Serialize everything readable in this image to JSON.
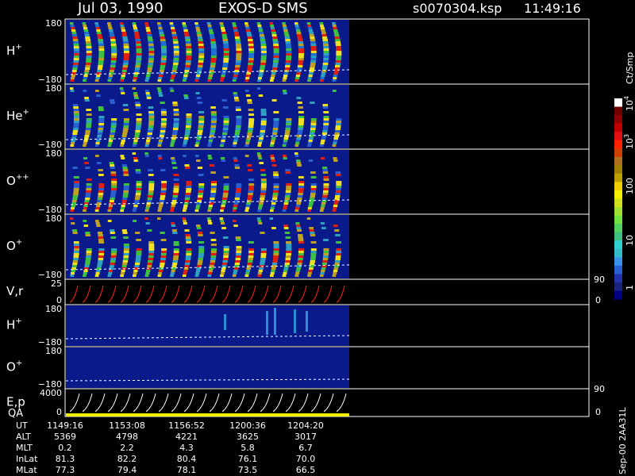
{
  "header": {
    "date": "Jul 03, 1990",
    "instrument": "EXOS-D SMS",
    "file": "s0070304.ksp",
    "time": "11:49:16"
  },
  "colorbar": {
    "unit": "Ct/Smp",
    "ticks": [
      "1",
      "10",
      "100",
      "10",
      "10"
    ],
    "tick_sup": [
      "",
      "",
      "",
      "3",
      "4"
    ],
    "colors": [
      "#000080",
      "#1a237e",
      "#2233aa",
      "#2a5fd0",
      "#3a8fe8",
      "#33bbcc",
      "#30d0d0",
      "#40c080",
      "#50d060",
      "#70e040",
      "#a0e030",
      "#d0e020",
      "#f0f000",
      "#f0d000",
      "#c0a000",
      "#a08000",
      "#b07020",
      "#d04000",
      "#ff2000",
      "#e01010",
      "#c00000",
      "#900000",
      "#700000",
      "#ffffff"
    ]
  },
  "panels": [
    {
      "label": "H",
      "sup": "+",
      "ymax": "180",
      "ymin": "−180",
      "kind": "spectro",
      "palette": [
        "#e02010",
        "#f0e020",
        "#40c040",
        "#2070d0",
        "#30a0c0",
        "#c0a020"
      ]
    },
    {
      "label": "He",
      "sup": "+",
      "ymax": "180",
      "ymin": "−180",
      "kind": "spectro",
      "palette": [
        "#f0e020",
        "#c0a020",
        "#40c040",
        "#2a5fd0",
        "#30a0c0"
      ]
    },
    {
      "label": "O",
      "sup": "++",
      "ymax": "180",
      "ymin": "−180",
      "kind": "spectro",
      "palette": [
        "#e02010",
        "#f0e020",
        "#c0a020",
        "#40c040",
        "#2a5fd0"
      ]
    },
    {
      "label": "O",
      "sup": "+",
      "ymax": "180",
      "ymin": "−180",
      "kind": "spectro",
      "palette": [
        "#c0a020",
        "#e02010",
        "#f0e020",
        "#40c040",
        "#30a0c0"
      ]
    },
    {
      "label": "V,r",
      "sup": "",
      "ymax": "25",
      "ymin": "0",
      "rmax": "90",
      "rmin": "0",
      "kind": "vr"
    },
    {
      "label": "H",
      "sup": "+",
      "ymax": "180",
      "ymin": "−180",
      "kind": "sparse"
    },
    {
      "label": "O",
      "sup": "+",
      "ymax": "180",
      "ymin": "−180",
      "kind": "empty"
    },
    {
      "label": "E,p",
      "label2": "QA",
      "sup": "",
      "ymax": "4000",
      "ymin": "0",
      "rmax": "90",
      "rmin": "0",
      "kind": "ep"
    }
  ],
  "bottom_right_label": "Sep-00 2AA31L",
  "orbit_table": {
    "rows": [
      {
        "name": "UT",
        "values": [
          "1149:16",
          "1153:08",
          "1156:52",
          "1200:36",
          "1204:20"
        ]
      },
      {
        "name": "ALT",
        "values": [
          "5369",
          "4798",
          "4221",
          "3625",
          "3017"
        ]
      },
      {
        "name": "MLT",
        "values": [
          "0.2",
          "2.2",
          "4.3",
          "5.8",
          "6.7"
        ]
      },
      {
        "name": "InLat",
        "values": [
          "81.3",
          "82.2",
          "80.4",
          "76.1",
          "70.0"
        ]
      },
      {
        "name": "MLat",
        "values": [
          "77.3",
          "79.4",
          "78.1",
          "73.5",
          "66.5"
        ]
      }
    ]
  },
  "chart_data": {
    "type": "heatmap",
    "title": "Jul 03, 1990 EXOS-D SMS",
    "subtitle": "s0070304.ksp 11:49:16",
    "x": [
      "1149:16",
      "1153:08",
      "1156:52",
      "1200:36",
      "1204:20"
    ],
    "xlabel": "UT",
    "colorbar_label": "Ct/Smp",
    "colorbar_range": [
      1,
      10000
    ],
    "colorbar_scale": "log",
    "series": [
      {
        "name": "H+",
        "ylim": [
          -180,
          180
        ]
      },
      {
        "name": "He+",
        "ylim": [
          -180,
          180
        ]
      },
      {
        "name": "O++",
        "ylim": [
          -180,
          180
        ]
      },
      {
        "name": "O+",
        "ylim": [
          -180,
          180
        ]
      },
      {
        "name": "V,r",
        "ylim": [
          0,
          25
        ],
        "ylim_right": [
          0,
          90
        ]
      },
      {
        "name": "H+",
        "ylim": [
          -180,
          180
        ]
      },
      {
        "name": "O+",
        "ylim": [
          -180,
          180
        ]
      },
      {
        "name": "E,p",
        "ylim": [
          0,
          4000
        ],
        "ylim_right": [
          0,
          90
        ]
      }
    ],
    "grid": false
  }
}
